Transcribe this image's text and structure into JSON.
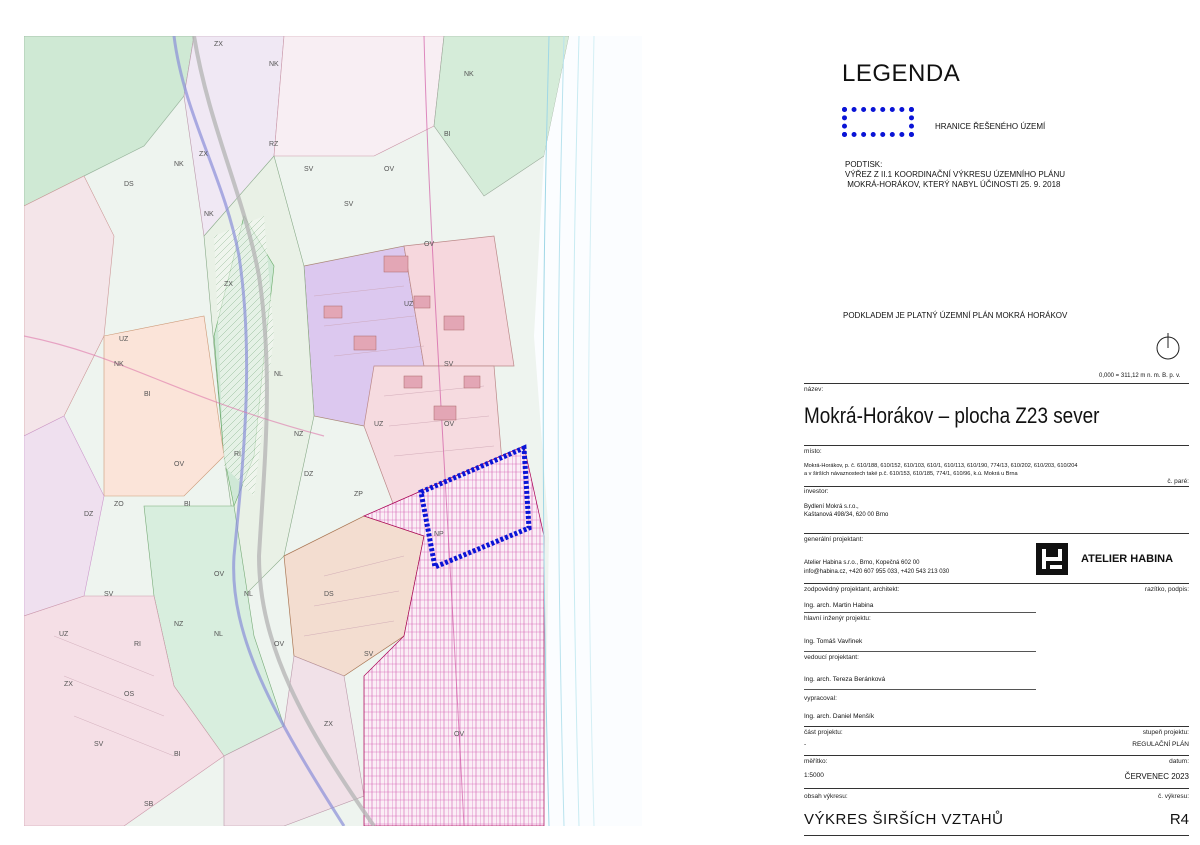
{
  "legend": {
    "title": "LEGENDA",
    "boundary_label": "HRANICE ŘEŠENÉHO ÚZEMÍ",
    "boundary_color": "#0a14d6",
    "podtisk": "PODTISK:\nVÝŘEZ Z II.1 KOORDINAČNÍ VÝKRESU ÚZEMNÍHO PLÁNU\n MOKRÁ-HORÁKOV, KTERÝ NABYL ÚČINOSTI 25. 9. 2018",
    "podklad": "PODKLADEM JE PLATNÝ ÚZEMNÍ PLÁN MOKRÁ HORÁKOV",
    "height_note": "0,000 = 311,12 m n. m. B. p. v."
  },
  "map": {
    "labels": [
      "ZX",
      "NK",
      "ZX",
      "NK",
      "RZ",
      "SV",
      "OV",
      "BI",
      "NK",
      "NK",
      "DS",
      "SV",
      "OV",
      "UZ",
      "ZX",
      "UZ",
      "SV",
      "NK",
      "NL",
      "OV",
      "NZ",
      "BI",
      "OV",
      "RI",
      "DZ",
      "BI",
      "NL",
      "OV",
      "ZP",
      "UZ",
      "DZ",
      "SV",
      "NZ",
      "UZ",
      "RI",
      "ZX",
      "OS",
      "NL",
      "ZX",
      "BI",
      "SV",
      "SB",
      "DS",
      "SV",
      "OV",
      "ZO",
      "OV",
      "NP"
    ]
  },
  "title_block": {
    "name_label": "název:",
    "name": "Mokrá-Horákov – plocha Z23 sever",
    "place_label": "místo:",
    "place_line1": "Mokrá-Horákov, p. č. 610/188, 610/152, 610/103, 610/1, 610/113, 610/190, 774/13, 610/202, 610/203, 610/204",
    "place_line2": "a v širších návaznostech také p.č. 610/153, 610/185, 774/1, 610/96, k.ú. Mokrá u Brna",
    "copy_label": "č. paré:",
    "investor_label": "investor:",
    "investor_line1": "Bydlení Mokrá s.r.o.,",
    "investor_line2": "Kaštanová 498/34, 620 00 Brno",
    "general_label": "generální projektant:",
    "general_line1": "Atelier Habina s.r.o., Brno, Kopečná 602 00",
    "general_line2": "info@habina.cz, +420 607 955 033, +420 543 213 030",
    "logo_text": "ATELIER HABINA",
    "responsible_label": "zodpovědný projektant, architekt:",
    "stamp_label": "razítko, podpis:",
    "responsible": "Ing. arch. Martin Habina",
    "chief_eng_label": "hlavní inženýr projektu:",
    "chief_eng": "Ing. Tomáš Vavřinek",
    "lead_label": "vedoucí projektant:",
    "lead": "Ing. arch. Tereza Beránková",
    "drafted_label": "vypracoval:",
    "drafted": "Ing. arch. Daniel Menšík",
    "part_label": "část projektu:",
    "part": "-",
    "stage_label": "stupeň projektu:",
    "stage": "REGULAČNÍ PLÁN",
    "scale_label": "měřítko:",
    "scale": "1:5000",
    "date_label": "datum:",
    "date": "ČERVENEC 2023",
    "content_label": "obsah výkresu:",
    "number_label": "č. výkresu:",
    "content": "VÝKRES ŠIRŠÍCH VZTAHŮ",
    "number": "R4"
  }
}
